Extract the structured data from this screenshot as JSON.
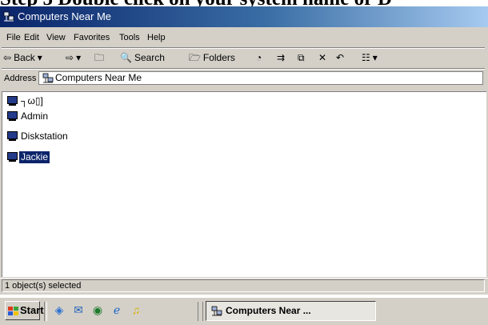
{
  "caption": "Step 5 Double click on your system name or D",
  "window": {
    "title": "Computers Near Me",
    "menu": [
      "File",
      "Edit",
      "View",
      "Favorites",
      "Tools",
      "Help"
    ],
    "toolbar": {
      "back": "Back",
      "search": "Search",
      "folders": "Folders",
      "views": "Views"
    },
    "address": {
      "label": "Address",
      "value": "Computers Near Me"
    },
    "items": [
      {
        "label": "┐ω▯]",
        "selected": false
      },
      {
        "label": "Admin",
        "selected": false
      },
      {
        "label": "Diskstation",
        "selected": false
      },
      {
        "label": "Jackie",
        "selected": true
      }
    ],
    "status": "1 object(s) selected"
  },
  "taskbar": {
    "start": "Start",
    "task_button": "Computers Near ..."
  }
}
